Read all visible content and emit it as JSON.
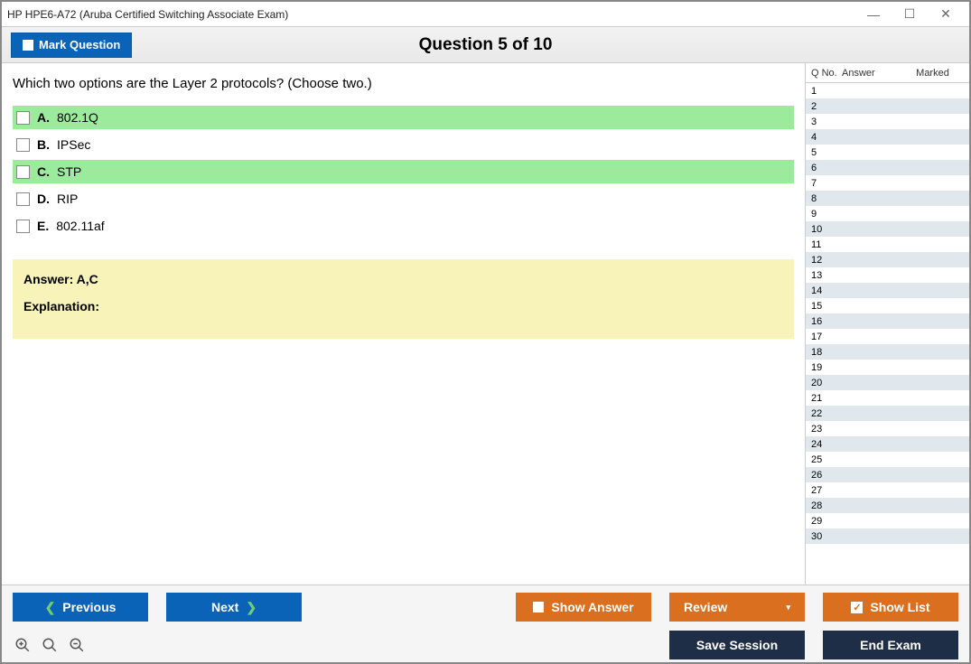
{
  "window": {
    "title": "HP HPE6-A72 (Aruba Certified Switching Associate Exam)"
  },
  "header": {
    "mark_label": "Mark Question",
    "question_title": "Question 5 of 10"
  },
  "question": {
    "text": "Which two options are the Layer 2 protocols? (Choose two.)",
    "answer_label": "Answer:",
    "answer_value": "A,C",
    "explanation_label": "Explanation:"
  },
  "options": [
    {
      "letter": "A.",
      "text": "802.1Q",
      "correct": true
    },
    {
      "letter": "B.",
      "text": "IPSec",
      "correct": false
    },
    {
      "letter": "C.",
      "text": "STP",
      "correct": true
    },
    {
      "letter": "D.",
      "text": "RIP",
      "correct": false
    },
    {
      "letter": "E.",
      "text": "802.11af",
      "correct": false
    }
  ],
  "sidebar": {
    "cols": {
      "qno": "Q No.",
      "answer": "Answer",
      "marked": "Marked"
    },
    "row_count": 30
  },
  "footer": {
    "previous": "Previous",
    "next": "Next",
    "show_answer": "Show Answer",
    "review": "Review",
    "show_list": "Show List",
    "save_session": "Save Session",
    "end_exam": "End Exam"
  }
}
